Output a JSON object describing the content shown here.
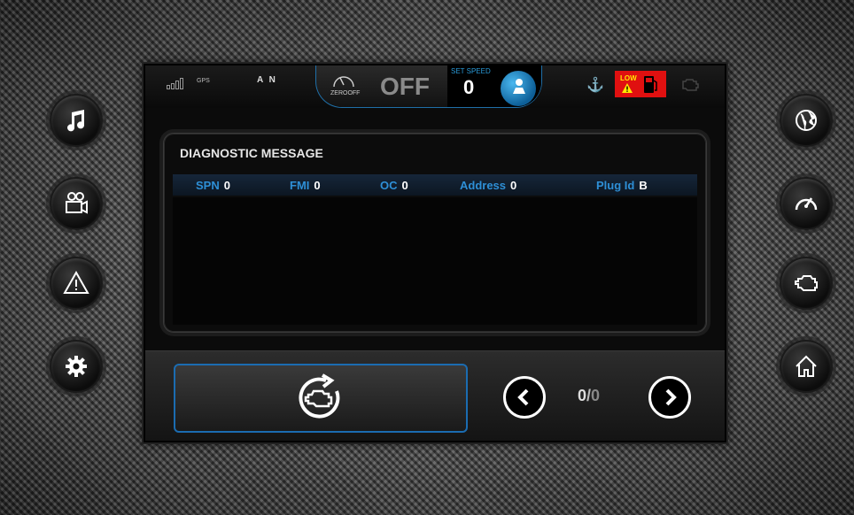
{
  "status_bar": {
    "gps_label": "GPS",
    "gear": "A N",
    "zero_off_label": "ZEROOFF",
    "zero_off_state": "OFF",
    "set_speed_label": "SET SPEED",
    "set_speed_value": "0",
    "low_fuel_label": "LOW"
  },
  "diagnostic": {
    "title": "DIAGNOSTIC MESSAGE",
    "fields": [
      {
        "key": "SPN",
        "value": "0"
      },
      {
        "key": "FMI",
        "value": "0"
      },
      {
        "key": "OC",
        "value": "0"
      },
      {
        "key": "Address",
        "value": "0"
      },
      {
        "key": "Plug Id",
        "value": "B"
      }
    ]
  },
  "pager": {
    "current": "0",
    "separator": "/",
    "total": "0"
  },
  "icons": {
    "left": [
      "music-note-icon",
      "video-camera-icon",
      "warning-icon",
      "settings-gear-icon"
    ],
    "right": [
      "globe-icon",
      "speedometer-icon",
      "engine-icon",
      "home-icon"
    ],
    "reset": "engine-refresh-icon"
  },
  "colors": {
    "accent_blue": "#2e8fd6",
    "warning_red": "#e01010",
    "warning_yellow": "#ffea00"
  }
}
